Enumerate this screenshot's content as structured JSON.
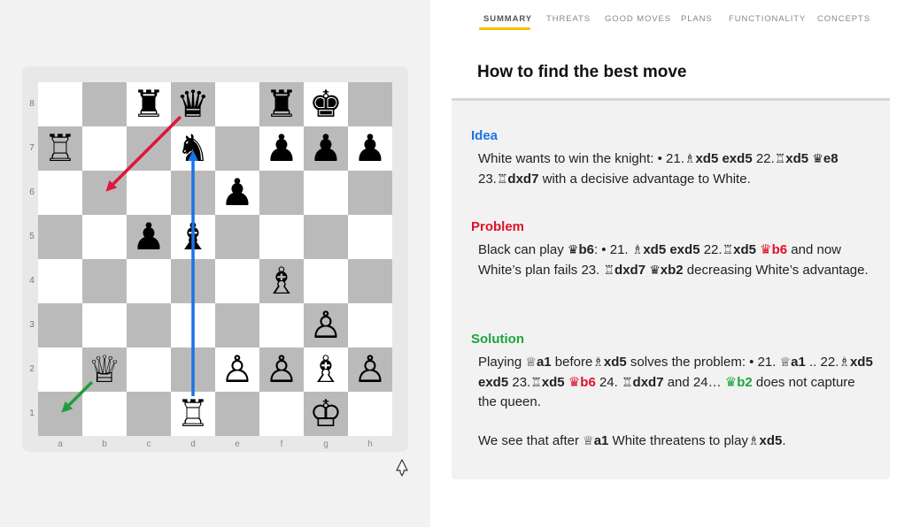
{
  "board": {
    "ranks": [
      "8",
      "7",
      "6",
      "5",
      "4",
      "3",
      "2",
      "1"
    ],
    "files": [
      "a",
      "b",
      "c",
      "d",
      "e",
      "f",
      "g",
      "h"
    ],
    "pieces": [
      {
        "square": "c8",
        "glyph": "♜",
        "name": "black-rook"
      },
      {
        "square": "d8",
        "glyph": "♛",
        "name": "black-queen"
      },
      {
        "square": "f8",
        "glyph": "♜",
        "name": "black-rook"
      },
      {
        "square": "g8",
        "glyph": "♚",
        "name": "black-king"
      },
      {
        "square": "a7",
        "glyph": "♖",
        "name": "white-rook"
      },
      {
        "square": "d7",
        "glyph": "♞",
        "name": "black-knight"
      },
      {
        "square": "f7",
        "glyph": "♟",
        "name": "black-pawn"
      },
      {
        "square": "g7",
        "glyph": "♟",
        "name": "black-pawn"
      },
      {
        "square": "h7",
        "glyph": "♟",
        "name": "black-pawn"
      },
      {
        "square": "e6",
        "glyph": "♟",
        "name": "black-pawn"
      },
      {
        "square": "c5",
        "glyph": "♟",
        "name": "black-pawn"
      },
      {
        "square": "d5",
        "glyph": "♝",
        "name": "black-bishop"
      },
      {
        "square": "f4",
        "glyph": "♗",
        "name": "white-bishop"
      },
      {
        "square": "g3",
        "glyph": "♙",
        "name": "white-pawn"
      },
      {
        "square": "b2",
        "glyph": "♕",
        "name": "white-queen"
      },
      {
        "square": "e2",
        "glyph": "♙",
        "name": "white-pawn"
      },
      {
        "square": "f2",
        "glyph": "♙",
        "name": "white-pawn"
      },
      {
        "square": "g2",
        "glyph": "♗",
        "name": "white-bishop"
      },
      {
        "square": "h2",
        "glyph": "♙",
        "name": "white-pawn"
      },
      {
        "square": "d1",
        "glyph": "♖",
        "name": "white-rook"
      },
      {
        "square": "g1",
        "glyph": "♔",
        "name": "white-king"
      }
    ],
    "arrows": [
      {
        "from": "d8",
        "to": "b6",
        "color": "#e0143c",
        "name": "arrow-d8-b6"
      },
      {
        "from": "d1",
        "to": "d7",
        "color": "#1a73e8",
        "name": "arrow-d1-d7"
      },
      {
        "from": "b2",
        "to": "a1",
        "color": "#1f9d3a",
        "name": "arrow-b2-a1"
      }
    ],
    "flip_icon": "flip-board-icon"
  },
  "tabs": [
    {
      "label": "SUMMARY",
      "active": true
    },
    {
      "label": "THREATS",
      "active": false
    },
    {
      "label": "GOOD MOVES",
      "active": false
    },
    {
      "label": "PLANS",
      "active": false
    },
    {
      "label": "FUNCTIONALITY",
      "active": false
    },
    {
      "label": "CONCEPTS",
      "active": false
    }
  ],
  "card": {
    "title": "How to find the best move",
    "sections": {
      "idea": {
        "title": "Idea",
        "color": "#1a73e8",
        "segments": [
          {
            "t": "White wants to win the knight: • 21."
          },
          {
            "t": "♗",
            "fig": true
          },
          {
            "t": "xd5",
            "b": true
          },
          {
            "t": "  "
          },
          {
            "t": "exd5",
            "b": true
          },
          {
            "t": "  22."
          },
          {
            "t": "♖",
            "fig": true
          },
          {
            "t": "xd5",
            "b": true
          },
          {
            "t": " "
          },
          {
            "t": "♛",
            "fig": true
          },
          {
            "t": "e8",
            "b": true
          },
          {
            "t": "  23."
          },
          {
            "t": "♖",
            "fig": true
          },
          {
            "t": "dxd7",
            "b": true
          },
          {
            "t": " with a decisive advantage to White."
          }
        ]
      },
      "problem": {
        "title": "Problem",
        "color": "#e0102a",
        "segments": [
          {
            "t": "Black can play "
          },
          {
            "t": "♛",
            "fig": true
          },
          {
            "t": "b6",
            "b": true
          },
          {
            "t": ": • 21. "
          },
          {
            "t": "♗",
            "fig": true
          },
          {
            "t": "xd5",
            "b": true
          },
          {
            "t": "  "
          },
          {
            "t": "exd5",
            "b": true
          },
          {
            "t": "  22."
          },
          {
            "t": "♖",
            "fig": true
          },
          {
            "t": "xd5",
            "b": true
          },
          {
            "t": " "
          },
          {
            "t": "♛b6",
            "red": true
          },
          {
            "t": " and now White’s plan fails  23. "
          },
          {
            "t": "♖",
            "fig": true
          },
          {
            "t": "dxd7",
            "b": true
          },
          {
            "t": " "
          },
          {
            "t": "♛",
            "fig": true
          },
          {
            "t": "xb2",
            "b": true
          },
          {
            "t": " decreasing White’s advantage."
          }
        ]
      },
      "solution": {
        "title": "Solution",
        "color": "#1ea53f",
        "segments": [
          {
            "t": "Playing "
          },
          {
            "t": "♕",
            "fig": true
          },
          {
            "t": "a1",
            "b": true
          },
          {
            "t": " before"
          },
          {
            "t": "♗",
            "fig": true
          },
          {
            "t": "xd5",
            "b": true
          },
          {
            "t": " solves the problem: • 21. "
          },
          {
            "t": "♕",
            "fig": true
          },
          {
            "t": "a1",
            "b": true
          },
          {
            "t": " .. 22."
          },
          {
            "t": "♗",
            "fig": true
          },
          {
            "t": "xd5",
            "b": true
          },
          {
            "t": "  "
          },
          {
            "t": "exd5",
            "b": true
          },
          {
            "t": "  23."
          },
          {
            "t": "♖",
            "fig": true
          },
          {
            "t": "xd5",
            "b": true
          },
          {
            "t": " "
          },
          {
            "t": "♛b6",
            "red": true
          },
          {
            "t": "  24. "
          },
          {
            "t": "♖",
            "fig": true
          },
          {
            "t": "dxd7",
            "b": true
          },
          {
            "t": " and  24… "
          },
          {
            "t": "♛b2",
            "green": true
          },
          {
            "t": " does not capture the queen."
          }
        ],
        "conclusion": [
          {
            "t": "We see that after "
          },
          {
            "t": "♕",
            "fig": true
          },
          {
            "t": "a1",
            "b": true
          },
          {
            "t": " White threatens to play"
          },
          {
            "t": "♗",
            "fig": true
          },
          {
            "t": "xd5",
            "b": true
          },
          {
            "t": "."
          }
        ]
      }
    }
  }
}
